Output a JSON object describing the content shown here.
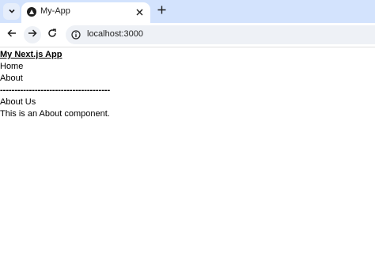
{
  "browser": {
    "tab_title": "My-App",
    "url": "localhost:3000"
  },
  "page": {
    "brand": "My Next.js App",
    "nav_links": [
      "Home",
      "About"
    ],
    "divider": "--------------------------------------",
    "heading": "About Us",
    "body_text": "This is an About component."
  },
  "icons": {
    "tab_search": "chevron-down-icon",
    "favicon": "nextjs-triangle-icon",
    "tab_close": "close-icon",
    "new_tab": "plus-icon",
    "back": "arrow-left-icon",
    "forward": "arrow-right-icon",
    "reload": "reload-icon",
    "site_info": "info-icon"
  },
  "colors": {
    "tabbar_bg": "#d3e3fd",
    "omnibox_bg": "#eef1f6"
  }
}
